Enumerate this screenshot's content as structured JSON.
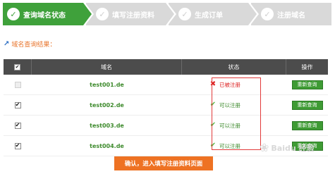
{
  "steps": [
    {
      "label": "查询域名状态",
      "icon": "check-icon",
      "active": true
    },
    {
      "label": "填写注册资料",
      "icon": "check-icon",
      "active": false
    },
    {
      "label": "生成订单",
      "icon": "check-icon",
      "active": false
    },
    {
      "label": "注册域名",
      "icon": "check-icon",
      "active": false
    }
  ],
  "result_label": "域名查询结果：",
  "table": {
    "headers": {
      "domain": "域名",
      "status": "状态",
      "action": "操作"
    },
    "rows": [
      {
        "domain": "test001.de",
        "status": "已被注册",
        "status_type": "taken",
        "checked": false,
        "action": "重新查询"
      },
      {
        "domain": "test002.de",
        "status": "可以注册",
        "status_type": "free",
        "checked": true,
        "action": "重新查询"
      },
      {
        "domain": "test003.de",
        "status": "可以注册",
        "status_type": "free",
        "checked": true,
        "action": "重新查询"
      },
      {
        "domain": "test004.de",
        "status": "可以注册",
        "status_type": "free",
        "checked": true,
        "action": "重新查询"
      }
    ]
  },
  "confirm_button": "确认，进入填写注册资料页面",
  "watermark": "Baidu 经验",
  "colors": {
    "accent_green": "#3fa13b",
    "step_inactive": "#d9d9d9",
    "orange": "#ee7223",
    "taken_red": "#dd2222",
    "header_dark": "#4c4c4c"
  }
}
